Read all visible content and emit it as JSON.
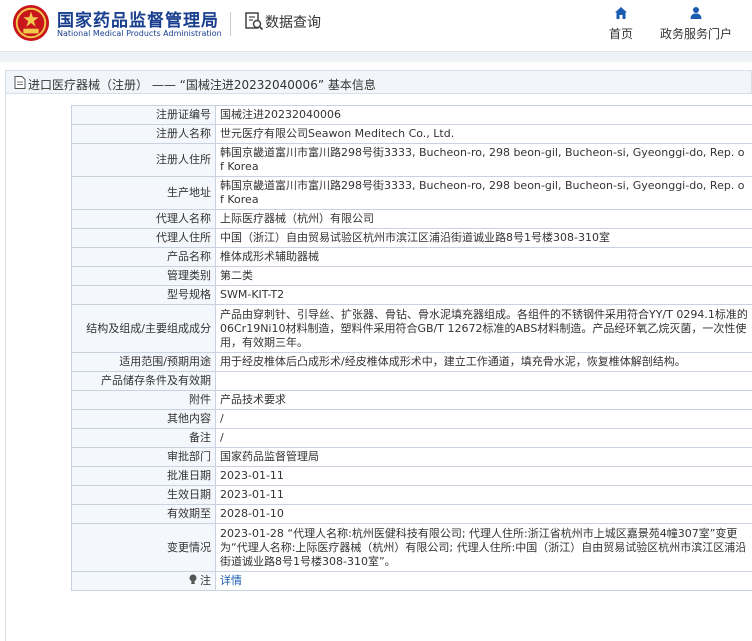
{
  "header": {
    "brand_cn": "国家药品监督管理局",
    "brand_en": "National Medical Products Administration",
    "data_query": "数据查询",
    "nav": [
      {
        "label": "首页",
        "icon": "home-icon"
      },
      {
        "label": "政务服务门户",
        "icon": "user-icon"
      }
    ],
    "accent_color": "#1a3f8f"
  },
  "breadcrumb": {
    "text": "进口医疗器械（注册） —— “国械注进20232040006” 基本信息"
  },
  "record": {
    "rows": [
      {
        "label": "注册证编号",
        "value": "国械注进20232040006"
      },
      {
        "label": "注册人名称",
        "value": "世元医疗有限公司Seawon Meditech Co., Ltd."
      },
      {
        "label": "注册人住所",
        "value": "韩国京畿道富川市富川路298号街3333, Bucheon-ro, 298 beon-gil, Bucheon-si, Gyeonggi-do, Rep. of Korea"
      },
      {
        "label": "生产地址",
        "value": "韩国京畿道富川市富川路298号街3333, Bucheon-ro, 298 beon-gil, Bucheon-si, Gyeonggi-do, Rep. of Korea"
      },
      {
        "label": "代理人名称",
        "value": "上际医疗器械（杭州）有限公司"
      },
      {
        "label": "代理人住所",
        "value": "中国（浙江）自由贸易试验区杭州市滨江区浦沿街道诚业路8号1号楼308-310室"
      },
      {
        "label": "产品名称",
        "value": "椎体成形术辅助器械"
      },
      {
        "label": "管理类别",
        "value": "第二类"
      },
      {
        "label": "型号规格",
        "value": "SWM-KIT-T2"
      },
      {
        "label": "结构及组成/主要组成成分",
        "value": "产品由穿刺针、引导丝、扩张器、骨钻、骨水泥填充器组成。各组件的不锈钢件采用符合YY/T 0294.1标准的06Cr19Ni10材料制造，塑料件采用符合GB/T 12672标准的ABS材料制造。产品经环氧乙烷灭菌，一次性使用，有效期三年。"
      },
      {
        "label": "适用范围/预期用途",
        "value": "用于经皮椎体后凸成形术/经皮椎体成形术中，建立工作通道，填充骨水泥，恢复椎体解剖结构。"
      },
      {
        "label": "产品储存条件及有效期",
        "value": ""
      },
      {
        "label": "附件",
        "value": "产品技术要求"
      },
      {
        "label": "其他内容",
        "value": "/"
      },
      {
        "label": "备注",
        "value": "/"
      },
      {
        "label": "审批部门",
        "value": "国家药品监督管理局"
      },
      {
        "label": "批准日期",
        "value": "2023-01-11"
      },
      {
        "label": "生效日期",
        "value": "2023-01-11"
      },
      {
        "label": "有效期至",
        "value": "2028-01-10"
      },
      {
        "label": "变更情况",
        "value": "2023-01-28 “代理人名称:杭州医健科技有限公司; 代理人住所:浙江省杭州市上城区嘉景苑4幢307室”变更为“代理人名称:上际医疗器械（杭州）有限公司; 代理人住所:中国（浙江）自由贸易试验区杭州市滨江区浦沿街道诚业路8号1号楼308-310室”。"
      }
    ],
    "note_label": "注",
    "note_icon": "bulb-icon",
    "note_link": "详情"
  }
}
